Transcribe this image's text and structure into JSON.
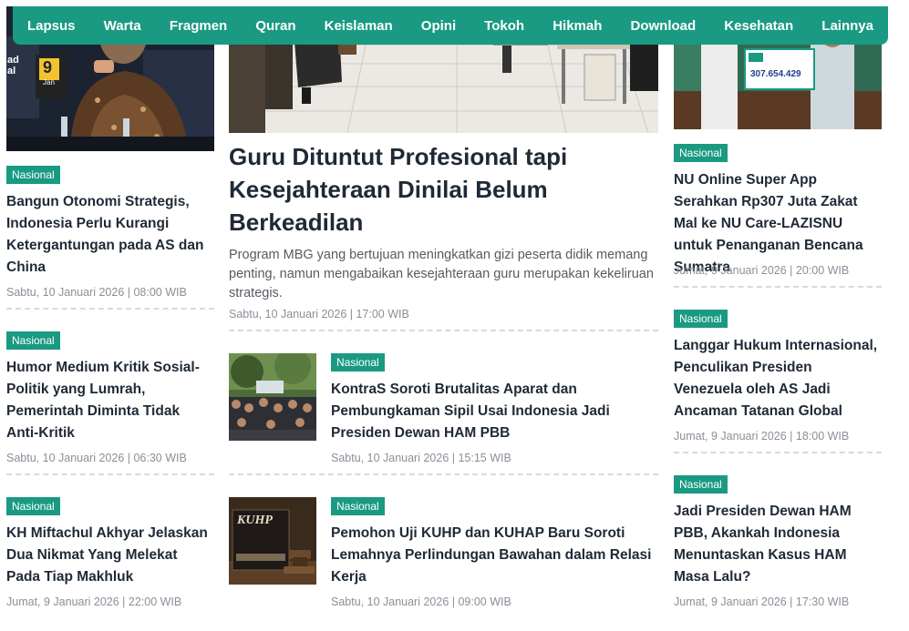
{
  "nav": {
    "items": [
      "Lapsus",
      "Warta",
      "Fragmen",
      "Quran",
      "Keislaman",
      "Opini",
      "Tokoh",
      "Hikmah",
      "Download",
      "Kesehatan",
      "Lainnya"
    ]
  },
  "colors": {
    "brand": "#1a9a82",
    "text": "#1f2937",
    "meta": "#8a8f98"
  },
  "left": [
    {
      "category": "Nasional",
      "title": "Bangun Otonomi Strategis, Indonesia Perlu Kurangi Ketergantungan pada AS dan China",
      "date": "Sabtu, 10 Januari 2026 | 08:00 WIB"
    },
    {
      "category": "Nasional",
      "title": "Humor Medium Kritik Sosial-Politik yang Lumrah, Pemerintah Diminta Tidak Anti-Kritik",
      "date": "Sabtu, 10 Januari 2026 | 06:30 WIB"
    },
    {
      "category": "Nasional",
      "title": "KH Miftachul Akhyar Jelaskan Dua Nikmat Yang Melekat Pada Tiap Makhluk",
      "date": "Jumat, 9 Januari 2026 | 22:00 WIB"
    }
  ],
  "left_image_text": {
    "sign": "ad al",
    "num": "9",
    "sub": "Jan"
  },
  "hero": {
    "title": "Guru Dituntut Profesional tapi Kesejahteraan Dinilai Belum Berkeadilan",
    "excerpt": "Program MBG yang bertujuan meningkatkan gizi peserta didik memang penting, namun mengabaikan kesejahteraan guru merupakan kekeliruan strategis.",
    "date": "Sabtu, 10 Januari 2026 | 17:00 WIB"
  },
  "middle": [
    {
      "category": "Nasional",
      "title": "KontraS Soroti Brutalitas Aparat dan Pembungkaman Sipil Usai Indonesia Jadi Presiden Dewan HAM PBB",
      "date": "Sabtu, 10 Januari 2026 | 15:15 WIB"
    },
    {
      "category": "Nasional",
      "title": "Pemohon Uji KUHP dan KUHAP Baru Soroti Lemahnya Perlindungan Bawahan dalam Relasi Kerja",
      "date": "Sabtu, 10 Januari 2026 | 09:00 WIB"
    }
  ],
  "book_label": "KUHP",
  "right_image_text": {
    "amount": "307.654.429"
  },
  "right": [
    {
      "category": "Nasional",
      "title": "NU Online Super App Serahkan Rp307 Juta Zakat Mal ke NU Care-LAZISNU untuk Penanganan Bencana Sumatra",
      "date": "Jumat, 9 Januari 2026 | 20:00 WIB"
    },
    {
      "category": "Nasional",
      "title": "Langgar Hukum Internasional, Penculikan Presiden Venezuela oleh AS Jadi Ancaman Tatanan Global",
      "date": "Jumat, 9 Januari 2026 | 18:00 WIB"
    },
    {
      "category": "Nasional",
      "title": "Jadi Presiden Dewan HAM PBB, Akankah Indonesia Menuntaskan Kasus HAM Masa Lalu?",
      "date": "Jumat, 9 Januari 2026 | 17:30 WIB"
    }
  ]
}
